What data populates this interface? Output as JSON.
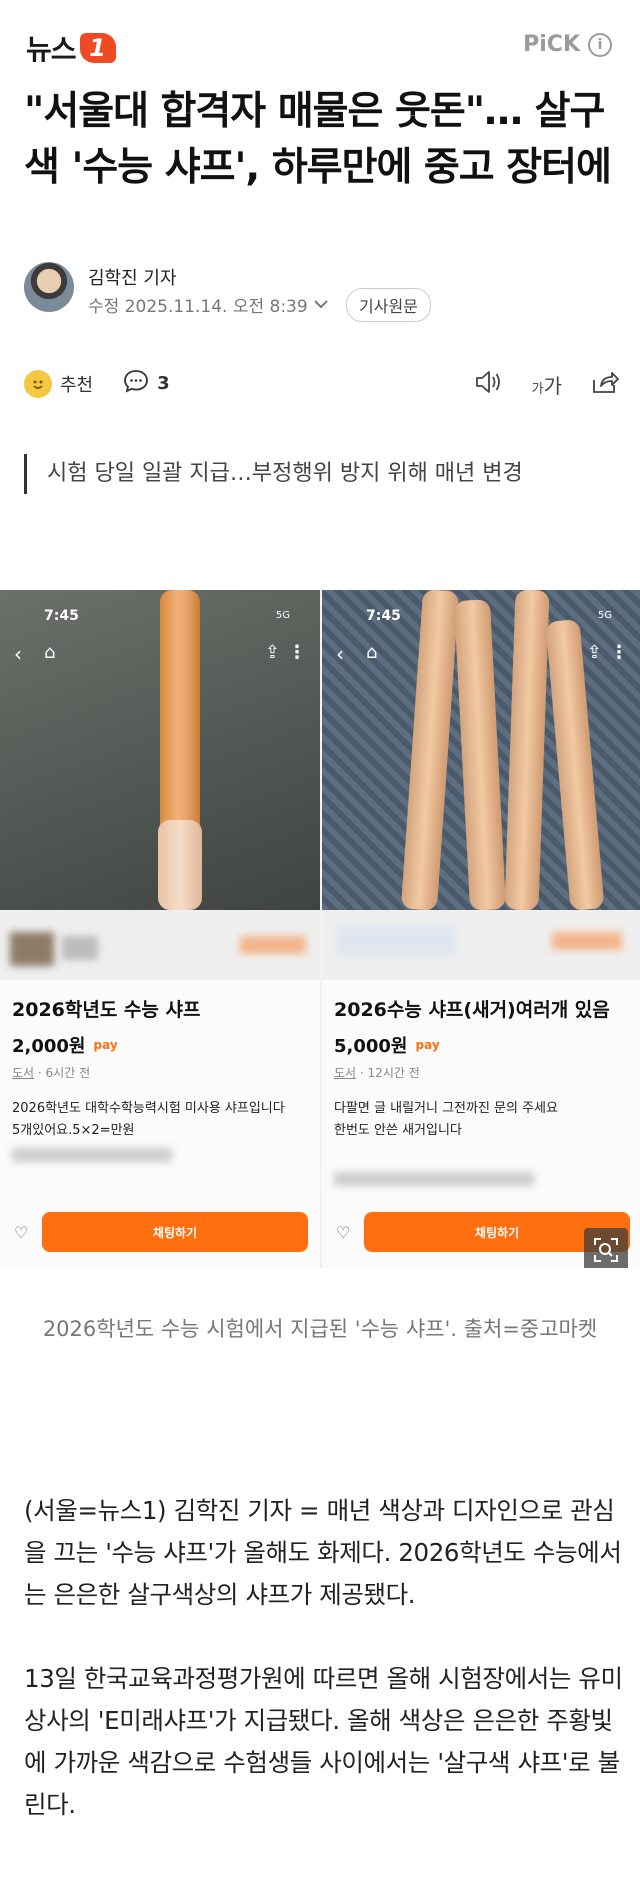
{
  "header": {
    "logo_text": "뉴스",
    "logo_badge": "1",
    "pick_label": "PiCK",
    "info_icon": "i"
  },
  "article": {
    "headline": "\"서울대 합격자 매물은 웃돈\"… 살구색 '수능 샤프', 하루만에 중고 장터에",
    "reporter": "김학진 기자",
    "timestamp": "수정 2025.11.14. 오전 8:39",
    "original_button": "기사원문",
    "subtitle": "시험 당일 일괄 지급…부정행위 방지 위해 매년 변경",
    "caption": "2026학년도 수능 시험에서 지급된 '수능 샤프'. 출처=중고마켓",
    "paragraphs": [
      "(서울=뉴스1) 김학진 기자 = 매년 색상과 디자인으로 관심을 끄는 '수능 샤프'가 올해도 화제다. 2026학년도 수능에서는 은은한 살구색상의 샤프가 제공됐다.",
      "13일 한국교육과정평가원에 따르면 올해 시험장에서는 유미상사의 'E미래샤프'가 지급됐다. 올해 색상은 은은한 주황빛에 가까운 색감으로 수험생들 사이에서는 '살구색 샤프'로 불린다."
    ]
  },
  "actions": {
    "recommend_label": "추천",
    "comment_count": "3",
    "font_size_label_small": "가",
    "font_size_label_large": "가"
  },
  "listings": [
    {
      "status_time": "7:45",
      "status_signal": "5G",
      "title": "2026학년도 수능 샤프",
      "price": "2,000원",
      "pay_badge": "pay",
      "category": "도서",
      "time_ago": "6시간 전",
      "description": "2026학년도 대학수학능력시험 미사용 샤프입니다",
      "description2": "5개있어요.5×2=만원",
      "chat_button": "채팅하기"
    },
    {
      "status_time": "7:45",
      "status_signal": "5G",
      "title": "2026수능 샤프(새거)여러개 있음",
      "price": "5,000원",
      "pay_badge": "pay",
      "category": "도서",
      "time_ago": "12시간 전",
      "description": "다팔면 글 내릴거니 그전까진 문의 주세요",
      "description2": "한번도 안쓴 새거입니다",
      "chat_button": "채팅하기"
    }
  ],
  "colors": {
    "brand": "#ee4a23",
    "chat_button": "#ff6f0f",
    "headline": "#111111"
  },
  "icons": {
    "recommend": "smile-emoji-icon",
    "comment": "speech-bubble-icon",
    "tts": "speaker-icon",
    "font_size": "font-size-icon",
    "share": "share-icon",
    "zoom": "zoom-expand-icon"
  }
}
